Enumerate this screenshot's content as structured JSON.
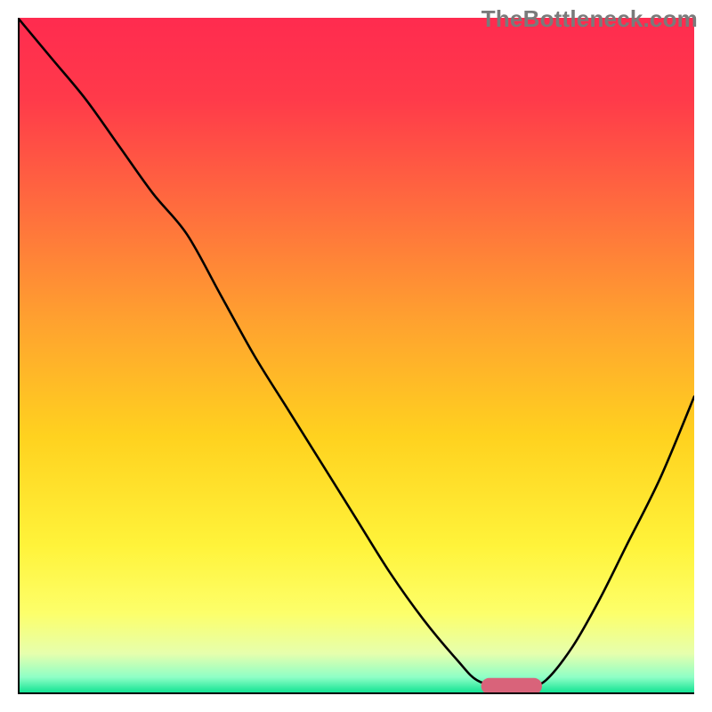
{
  "watermark": "TheBottleneck.com",
  "chart_data": {
    "type": "line",
    "title": "",
    "xlabel": "",
    "ylabel": "",
    "xlim": [
      0,
      100
    ],
    "ylim": [
      0,
      100
    ],
    "series": [
      {
        "name": "curve",
        "x": [
          0,
          5,
          10,
          15,
          20,
          25,
          30,
          35,
          40,
          45,
          50,
          55,
          60,
          65,
          68,
          72,
          75,
          78,
          82,
          86,
          90,
          95,
          100
        ],
        "y": [
          100,
          94,
          88,
          81,
          74,
          68,
          59,
          50,
          42,
          34,
          26,
          18,
          11,
          5,
          2,
          1,
          1,
          2,
          7,
          14,
          22,
          32,
          44
        ]
      }
    ],
    "marker": {
      "name": "optimal-region",
      "x_center": 73,
      "y": 1.2,
      "width": 9,
      "height": 2.4,
      "color": "#d9637a"
    },
    "gradient_stops": [
      {
        "offset": 0.0,
        "color": "#ff2b4f"
      },
      {
        "offset": 0.12,
        "color": "#ff3a4a"
      },
      {
        "offset": 0.28,
        "color": "#ff6c3e"
      },
      {
        "offset": 0.45,
        "color": "#ffa22f"
      },
      {
        "offset": 0.62,
        "color": "#ffd21f"
      },
      {
        "offset": 0.78,
        "color": "#fff33a"
      },
      {
        "offset": 0.88,
        "color": "#fdff6a"
      },
      {
        "offset": 0.94,
        "color": "#e6ffad"
      },
      {
        "offset": 0.975,
        "color": "#8effc6"
      },
      {
        "offset": 1.0,
        "color": "#05e08e"
      }
    ],
    "axis_color": "#000000",
    "curve_color": "#000000",
    "curve_width": 2.6
  }
}
